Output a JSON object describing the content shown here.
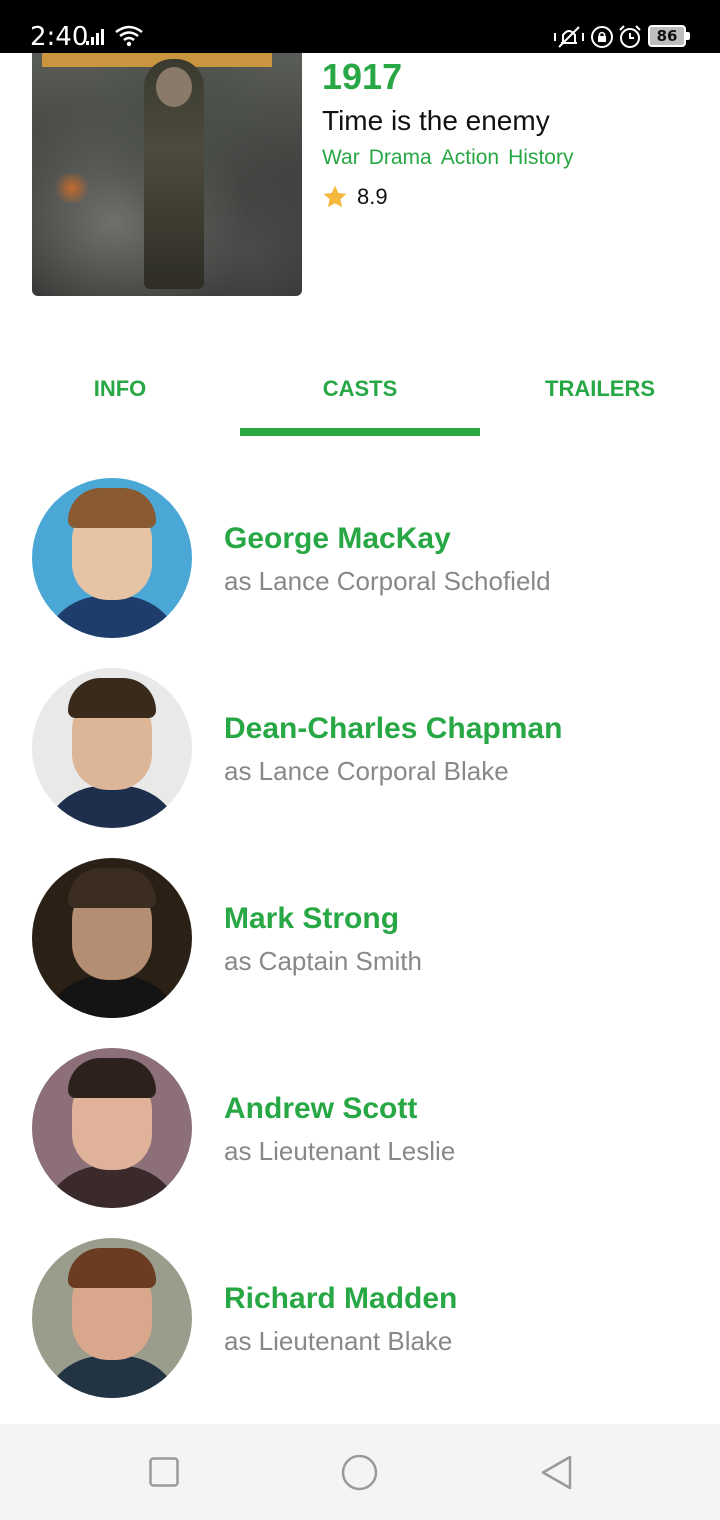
{
  "status_bar": {
    "time": "2:40",
    "battery": "86"
  },
  "movie": {
    "title": "1917",
    "tagline": "Time is the enemy",
    "genres": [
      "War",
      "Drama",
      "Action",
      "History"
    ],
    "rating": "8.9"
  },
  "tabs": [
    {
      "label": "INFO"
    },
    {
      "label": "CASTS",
      "active": true
    },
    {
      "label": "TRAILERS"
    }
  ],
  "cast": [
    {
      "name": "George MacKay",
      "role": "as Lance Corporal Schofield"
    },
    {
      "name": "Dean-Charles Chapman",
      "role": "as Lance Corporal Blake"
    },
    {
      "name": "Mark Strong",
      "role": "as Captain Smith"
    },
    {
      "name": "Andrew Scott",
      "role": "as Lieutenant Leslie"
    },
    {
      "name": "Richard Madden",
      "role": "as Lieutenant Blake"
    }
  ],
  "colors": {
    "accent": "#28a745",
    "role_text": "#888888"
  },
  "icons": {
    "rating": "star-icon",
    "nav": [
      "recents-square-icon",
      "home-circle-icon",
      "back-triangle-icon"
    ]
  }
}
